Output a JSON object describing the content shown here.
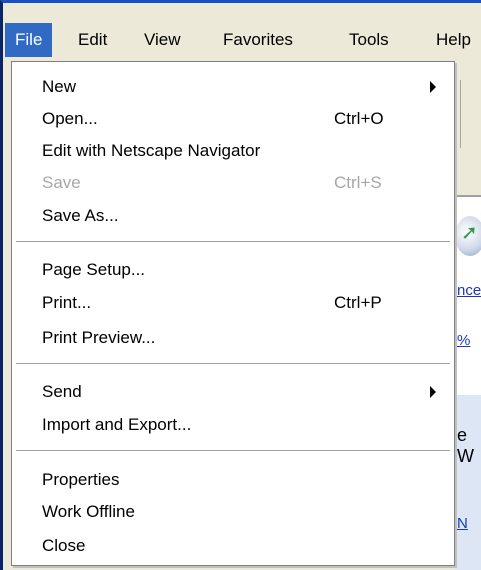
{
  "menubar": {
    "items": [
      {
        "label": "File",
        "active": true
      },
      {
        "label": "Edit"
      },
      {
        "label": "View"
      },
      {
        "label": "Favorites"
      },
      {
        "label": "Tools"
      },
      {
        "label": "Help"
      }
    ]
  },
  "file_menu": {
    "groups": [
      [
        {
          "label": "New",
          "shortcut": "",
          "submenu": true
        },
        {
          "label": "Open...",
          "shortcut": "Ctrl+O"
        },
        {
          "label": "Edit with Netscape Navigator",
          "shortcut": ""
        },
        {
          "label": "Save",
          "shortcut": "Ctrl+S",
          "disabled": true
        },
        {
          "label": "Save As...",
          "shortcut": ""
        }
      ],
      [
        {
          "label": "Page Setup...",
          "shortcut": ""
        },
        {
          "label": "Print...",
          "shortcut": "Ctrl+P"
        },
        {
          "label": "Print Preview...",
          "shortcut": ""
        }
      ],
      [
        {
          "label": "Send",
          "shortcut": "",
          "submenu": true
        },
        {
          "label": "Import and Export...",
          "shortcut": ""
        }
      ],
      [
        {
          "label": "Properties",
          "shortcut": ""
        },
        {
          "label": "Work Offline",
          "shortcut": ""
        },
        {
          "label": "Close",
          "shortcut": ""
        }
      ]
    ]
  },
  "background": {
    "link_fragment_1": "nce",
    "link_fragment_2": "%",
    "text_fragment": "e W",
    "link_fragment_3": "N"
  },
  "colors": {
    "menu_highlight": "#316ac5",
    "disabled_text": "#a7a6aa",
    "menubar_bg": "#ece9d8"
  }
}
